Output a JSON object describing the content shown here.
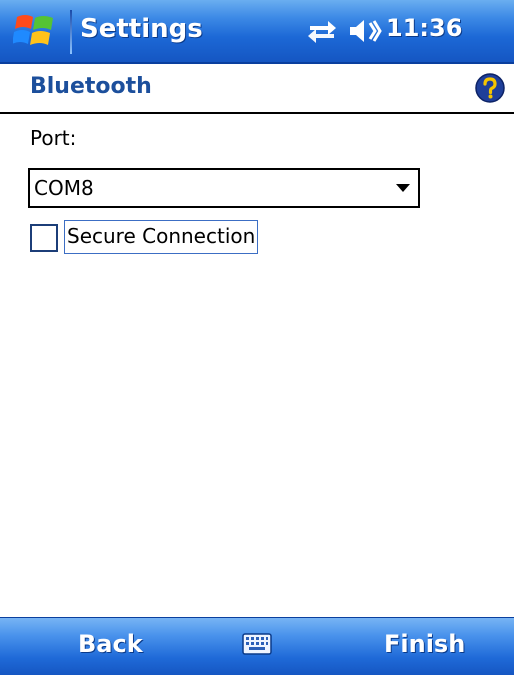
{
  "titlebar": {
    "app_title": "Settings",
    "clock": "11:36",
    "icons": [
      "windows-logo-icon",
      "connectivity-arrows-icon",
      "speaker-icon"
    ]
  },
  "header": {
    "title": "Bluetooth",
    "help_icon": "help-question-icon"
  },
  "form": {
    "port_label": "Port:",
    "port_value": "COM8",
    "secure_label": "Secure Connection",
    "secure_checked": false
  },
  "menubar": {
    "left_label": "Back",
    "right_label": "Finish",
    "center_icon": "keyboard-icon"
  },
  "colors": {
    "titlebar": "#1c68d6",
    "header_text": "#1c4f9c",
    "help_icon_fill": "#1f3f9a",
    "help_icon_mark": "#f5c400"
  }
}
